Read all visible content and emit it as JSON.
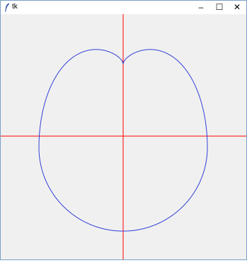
{
  "window": {
    "title": "tk",
    "minimize_glyph": "–",
    "maximize_glyph": "☐",
    "close_glyph": "✕",
    "icon": "feather-icon"
  },
  "colors": {
    "axis": "#ff0000",
    "curve": "#3340d8",
    "canvas_bg": "#f0f0f0"
  }
}
